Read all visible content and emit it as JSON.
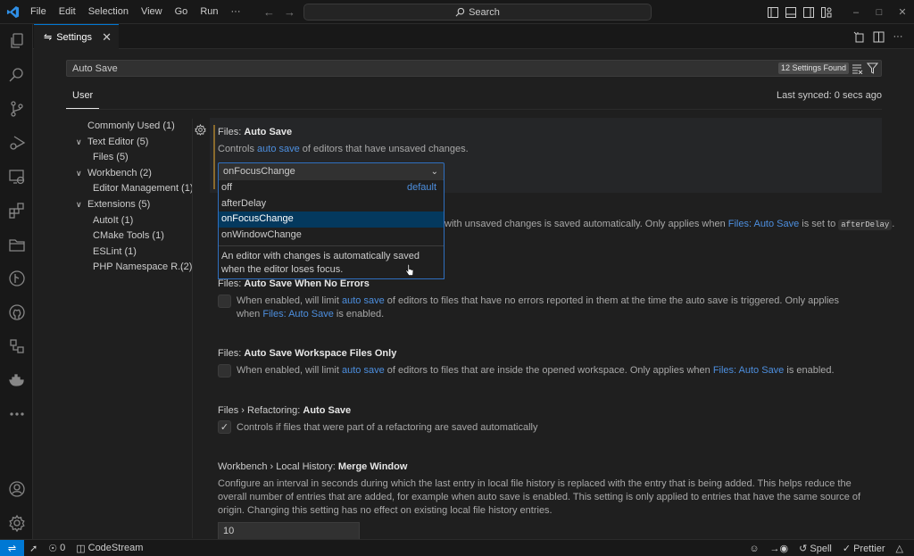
{
  "titlebar": {
    "menu": [
      "File",
      "Edit",
      "Selection",
      "View",
      "Go",
      "Run",
      "···"
    ],
    "search_label": "Search"
  },
  "tab": {
    "label": "Settings"
  },
  "search": {
    "value": "Auto Save",
    "results_count": "12 Settings Found"
  },
  "scope": {
    "tab": "User",
    "sync_status": "Last synced: 0 secs ago"
  },
  "toc": [
    {
      "label": "Commonly Used (1)",
      "level": 0,
      "expandable": false
    },
    {
      "label": "Text Editor (5)",
      "level": 0,
      "expandable": true
    },
    {
      "label": "Files (5)",
      "level": 1,
      "expandable": false
    },
    {
      "label": "Workbench (2)",
      "level": 0,
      "expandable": true
    },
    {
      "label": "Editor Management (1)",
      "level": 1,
      "expandable": false
    },
    {
      "label": "Extensions (5)",
      "level": 0,
      "expandable": true
    },
    {
      "label": "AutoIt (1)",
      "level": 1,
      "expandable": false
    },
    {
      "label": "CMake Tools (1)",
      "level": 1,
      "expandable": false
    },
    {
      "label": "ESLint (1)",
      "level": 1,
      "expandable": false
    },
    {
      "label": "PHP Namespace R...",
      "count": "(2)",
      "level": 1,
      "expandable": false
    }
  ],
  "settings": {
    "auto_save": {
      "category": "Files: ",
      "name": "Auto Save",
      "desc_pre": "Controls ",
      "desc_link": "auto save",
      "desc_post": " of editors that have unsaved changes.",
      "value": "onFocusChange",
      "options": [
        {
          "label": "off",
          "tag": "default"
        },
        {
          "label": "afterDelay"
        },
        {
          "label": "onFocusChange",
          "selected": true
        },
        {
          "label": "onWindowChange"
        }
      ],
      "option_description": "An editor with changes is automatically saved when the editor loses focus."
    },
    "auto_save_delay": {
      "desc_pre": "with unsaved changes is saved automatically. Only applies when ",
      "desc_link": "Files: Auto Save",
      "desc_mid": " is set to ",
      "desc_code": "afterDelay",
      "desc_post": "."
    },
    "when_no_errors": {
      "category": "Files: ",
      "name": "Auto Save When No Errors",
      "desc_pre": "When enabled, will limit ",
      "desc_link": "auto save",
      "desc_mid": " of editors to files that have no errors reported in them at the time the auto save is triggered. Only applies when ",
      "desc_link2": "Files: Auto Save",
      "desc_post": " is enabled.",
      "checked": false
    },
    "workspace_only": {
      "category": "Files: ",
      "name": "Auto Save Workspace Files Only",
      "desc_pre": "When enabled, will limit ",
      "desc_link": "auto save",
      "desc_mid": " of editors to files that are inside the opened workspace. Only applies when ",
      "desc_link2": "Files: Auto Save",
      "desc_post": " is enabled.",
      "checked": false
    },
    "refactoring": {
      "category": "Files › Refactoring: ",
      "name": "Auto Save",
      "desc": "Controls if files that were part of a refactoring are saved automatically",
      "checked": true
    },
    "merge_window": {
      "category": "Workbench › Local History: ",
      "name": "Merge Window",
      "desc": "Configure an interval in seconds during which the last entry in local file history is replaced with the entry that is being added. This helps reduce the overall number of entries that are added, for example when auto save is enabled. This setting is only applied to entries that have the same source of origin. Changing this setting has no effect on existing local file history entries.",
      "value": "10"
    }
  },
  "statusbar": {
    "ports": "0",
    "codestream": "CodeStream",
    "spell": "Spell",
    "prettier": "Prettier"
  },
  "colors": {
    "accent": "#0078d4",
    "link": "#4d8fdf",
    "selected_option": "#04395e"
  }
}
